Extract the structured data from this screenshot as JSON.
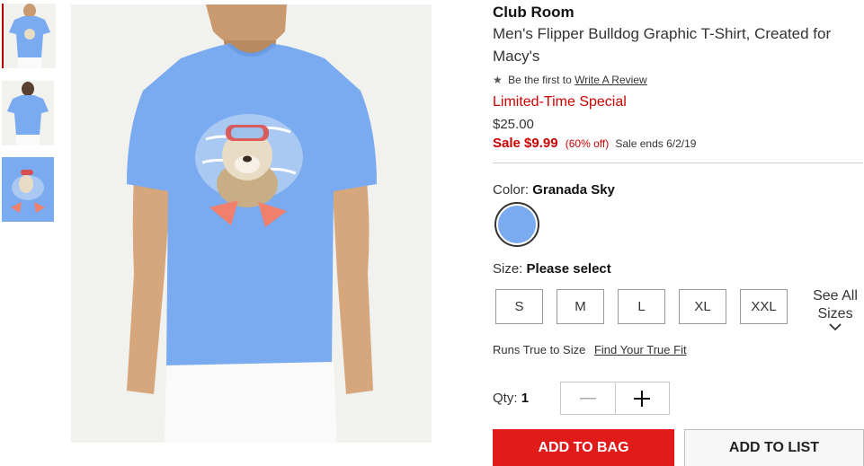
{
  "gallery": {
    "thumbnails": [
      {
        "label": "",
        "selected": true
      },
      {
        "label": "",
        "selected": false
      },
      {
        "label": "",
        "selected": false
      }
    ],
    "shirt_color": "#7aaaf0"
  },
  "product": {
    "brand": "Club Room",
    "title": "Men's Flipper Bulldog Graphic T-Shirt, Created for Macy's",
    "review_prefix": "Be the first to",
    "review_link": "Write A Review",
    "promo": "Limited-Time Special",
    "original_price": "$25.00",
    "sale_price": "Sale $9.99",
    "discount": "(60% off)",
    "sale_ends": "Sale ends 6/2/19"
  },
  "color": {
    "label": "Color:",
    "value": "Granada Sky",
    "swatch_hex": "#7aaaf0"
  },
  "size": {
    "label": "Size:",
    "value": "Please select",
    "options": [
      "S",
      "M",
      "L",
      "XL",
      "XXL"
    ],
    "see_all_line1": "See All",
    "see_all_line2": "Sizes",
    "runs_text": "Runs True to Size",
    "fit_link": "Find Your True Fit"
  },
  "quantity": {
    "label": "Qty:",
    "value": "1"
  },
  "actions": {
    "add_to_bag": "ADD TO BAG",
    "add_to_list": "ADD TO LIST"
  },
  "colors": {
    "sale_red": "#cc0000",
    "button_red": "#e11a1a"
  }
}
